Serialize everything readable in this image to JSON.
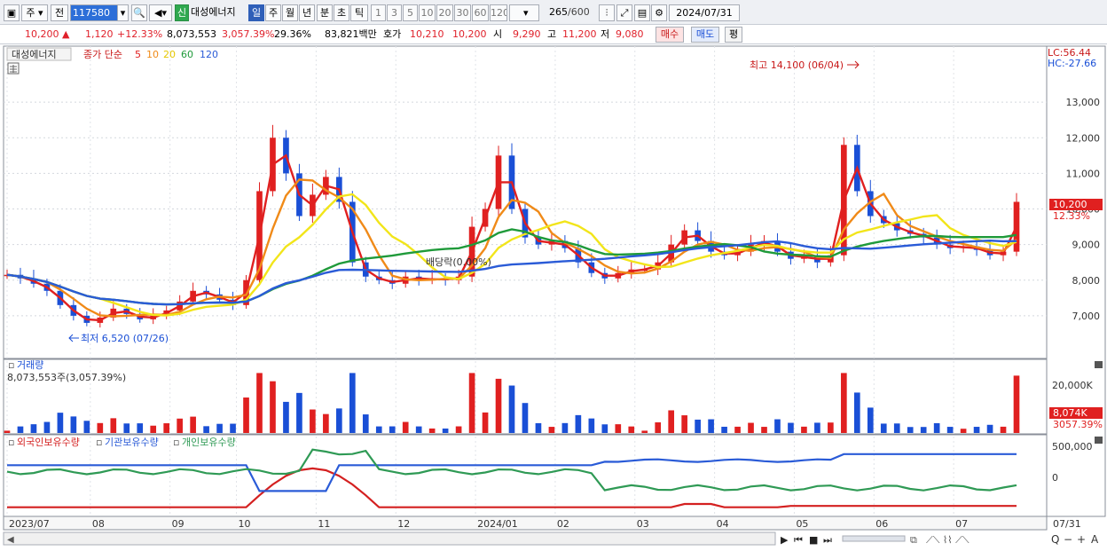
{
  "toolbar": {
    "period_type": "주",
    "prev_label": "전",
    "code": "117580",
    "new_badge": "신",
    "stock_name": "대성에너지",
    "tabs": [
      "일",
      "주",
      "월",
      "년",
      "분",
      "초",
      "틱"
    ],
    "active_tab": "일",
    "intervals": [
      "1",
      "3",
      "5",
      "10",
      "20",
      "30",
      "60",
      "120"
    ],
    "count": "265",
    "count_max": "/600",
    "date": "2024/07/31"
  },
  "quote": {
    "price": "10,200",
    "change": "1,120",
    "change_pct": "+12.33%",
    "volume": "8,073,553",
    "volume_pct": "3,057.39%",
    "turnover_pct": "29.36%",
    "amount": "83,821백만",
    "bid_label": "호가",
    "ask": "10,210",
    "bid": "10,200",
    "open_label": "시",
    "open": "9,290",
    "high_label": "고",
    "high": "11,200",
    "low_label": "저",
    "low": "9,080",
    "buy_label": "매수",
    "sell_label": "매도",
    "avg_label": "평"
  },
  "legend": {
    "name": "대성에너지",
    "title": "종가 단순",
    "ma": [
      {
        "label": "5",
        "color": "#e02020"
      },
      {
        "label": "10",
        "color": "#f08a18"
      },
      {
        "label": "20",
        "color": "#f2e51a"
      },
      {
        "label": "60",
        "color": "#1f9a3a"
      },
      {
        "label": "120",
        "color": "#2a5bd7"
      }
    ]
  },
  "price_panel": {
    "lc": "LC:56.44",
    "hc": "HC:-27.66",
    "y_ticks": [
      "13,000",
      "12,000",
      "11,000",
      "10,000",
      "9,000",
      "8,000",
      "7,000"
    ],
    "current_price": "10,200",
    "current_pct": "12.33%",
    "high_note": "최고 14,100 (06/04)",
    "low_note": "최저 6,520 (07/26)",
    "dividend_note": "배당락(0.00%)"
  },
  "volume_panel": {
    "title": "거래량",
    "info": "8,073,553주(3,057.39%)",
    "y_tick": "20,000K",
    "current": "8,074K",
    "current_pct": "3057.39%"
  },
  "holdings_panel": {
    "series": [
      {
        "name": "외국인보유수량",
        "color": "#d42020"
      },
      {
        "name": "기관보유수량",
        "color": "#2a5bd7"
      },
      {
        "name": "개인보유수량",
        "color": "#2f9a55"
      }
    ],
    "y_ticks": [
      "500,000",
      "0"
    ]
  },
  "x_axis": {
    "labels": [
      "2023/07",
      "08",
      "09",
      "10",
      "11",
      "12",
      "2024/01",
      "02",
      "03",
      "04",
      "05",
      "06",
      "07"
    ],
    "right_label": "07/31"
  },
  "chart_data": {
    "type": "candlestick",
    "ylim": [
      6000,
      14100
    ],
    "closes": [
      8150,
      8050,
      7900,
      7700,
      7300,
      7000,
      6800,
      6950,
      7200,
      7050,
      6900,
      7000,
      7150,
      7400,
      7700,
      7600,
      7450,
      7300,
      8000,
      10500,
      12000,
      11000,
      9800,
      10400,
      10900,
      10200,
      8500,
      8100,
      8000,
      7900,
      8100,
      8000,
      8050,
      8000,
      8100,
      9500,
      10000,
      11500,
      10000,
      9200,
      9000,
      9100,
      8900,
      8500,
      8200,
      8050,
      8200,
      8300,
      8300,
      8500,
      9000,
      9400,
      9100,
      8800,
      8700,
      8800,
      9000,
      9100,
      8800,
      8600,
      8700,
      8500,
      8700,
      11800,
      10500,
      9800,
      9600,
      9400,
      9300,
      9200,
      9000,
      8900,
      8950,
      8850,
      8700,
      8800,
      10200
    ]
  }
}
